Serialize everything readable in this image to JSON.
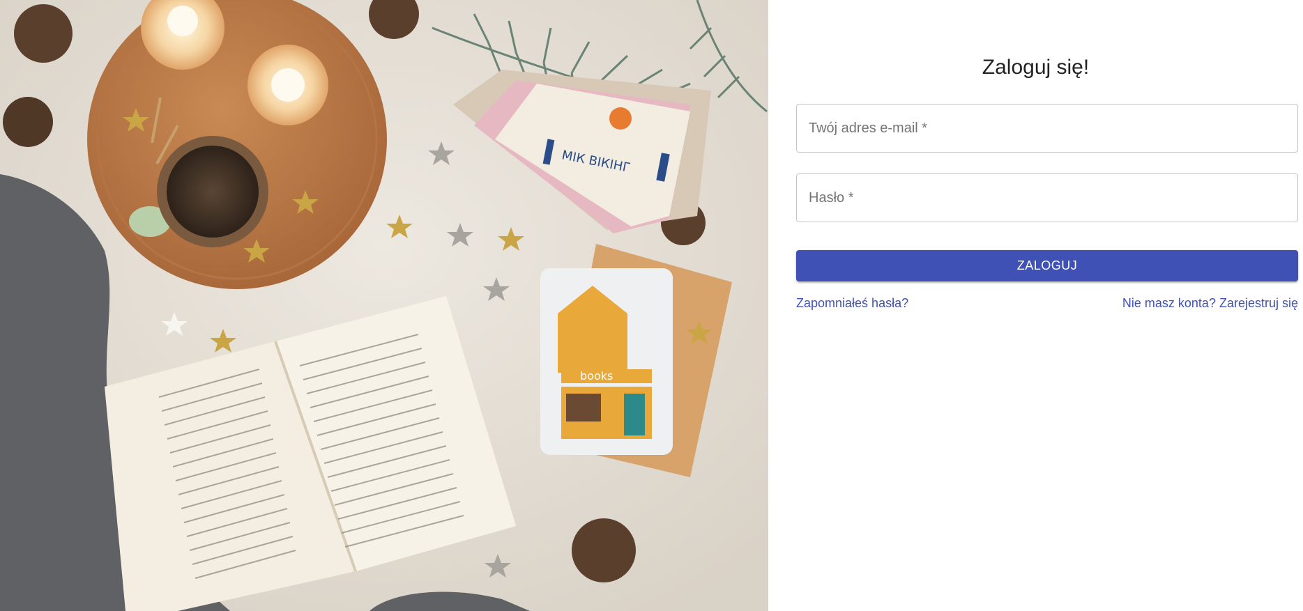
{
  "hero": {
    "book_cover_title": "МІК ВІКІНГ",
    "card_sign": "books"
  },
  "login": {
    "title": "Zaloguj się!",
    "email_placeholder": "Twój adres e-mail *",
    "password_placeholder": "Hasło *",
    "submit_label": "ZALOGUJ",
    "forgot_password_link": "Zapomniałeś hasła?",
    "register_link": "Nie masz konta? Zarejestruj się"
  },
  "colors": {
    "primary": "#3f51b5",
    "field_border": "#c4c4c4",
    "title_text": "#222222",
    "placeholder_text": "#757575"
  }
}
